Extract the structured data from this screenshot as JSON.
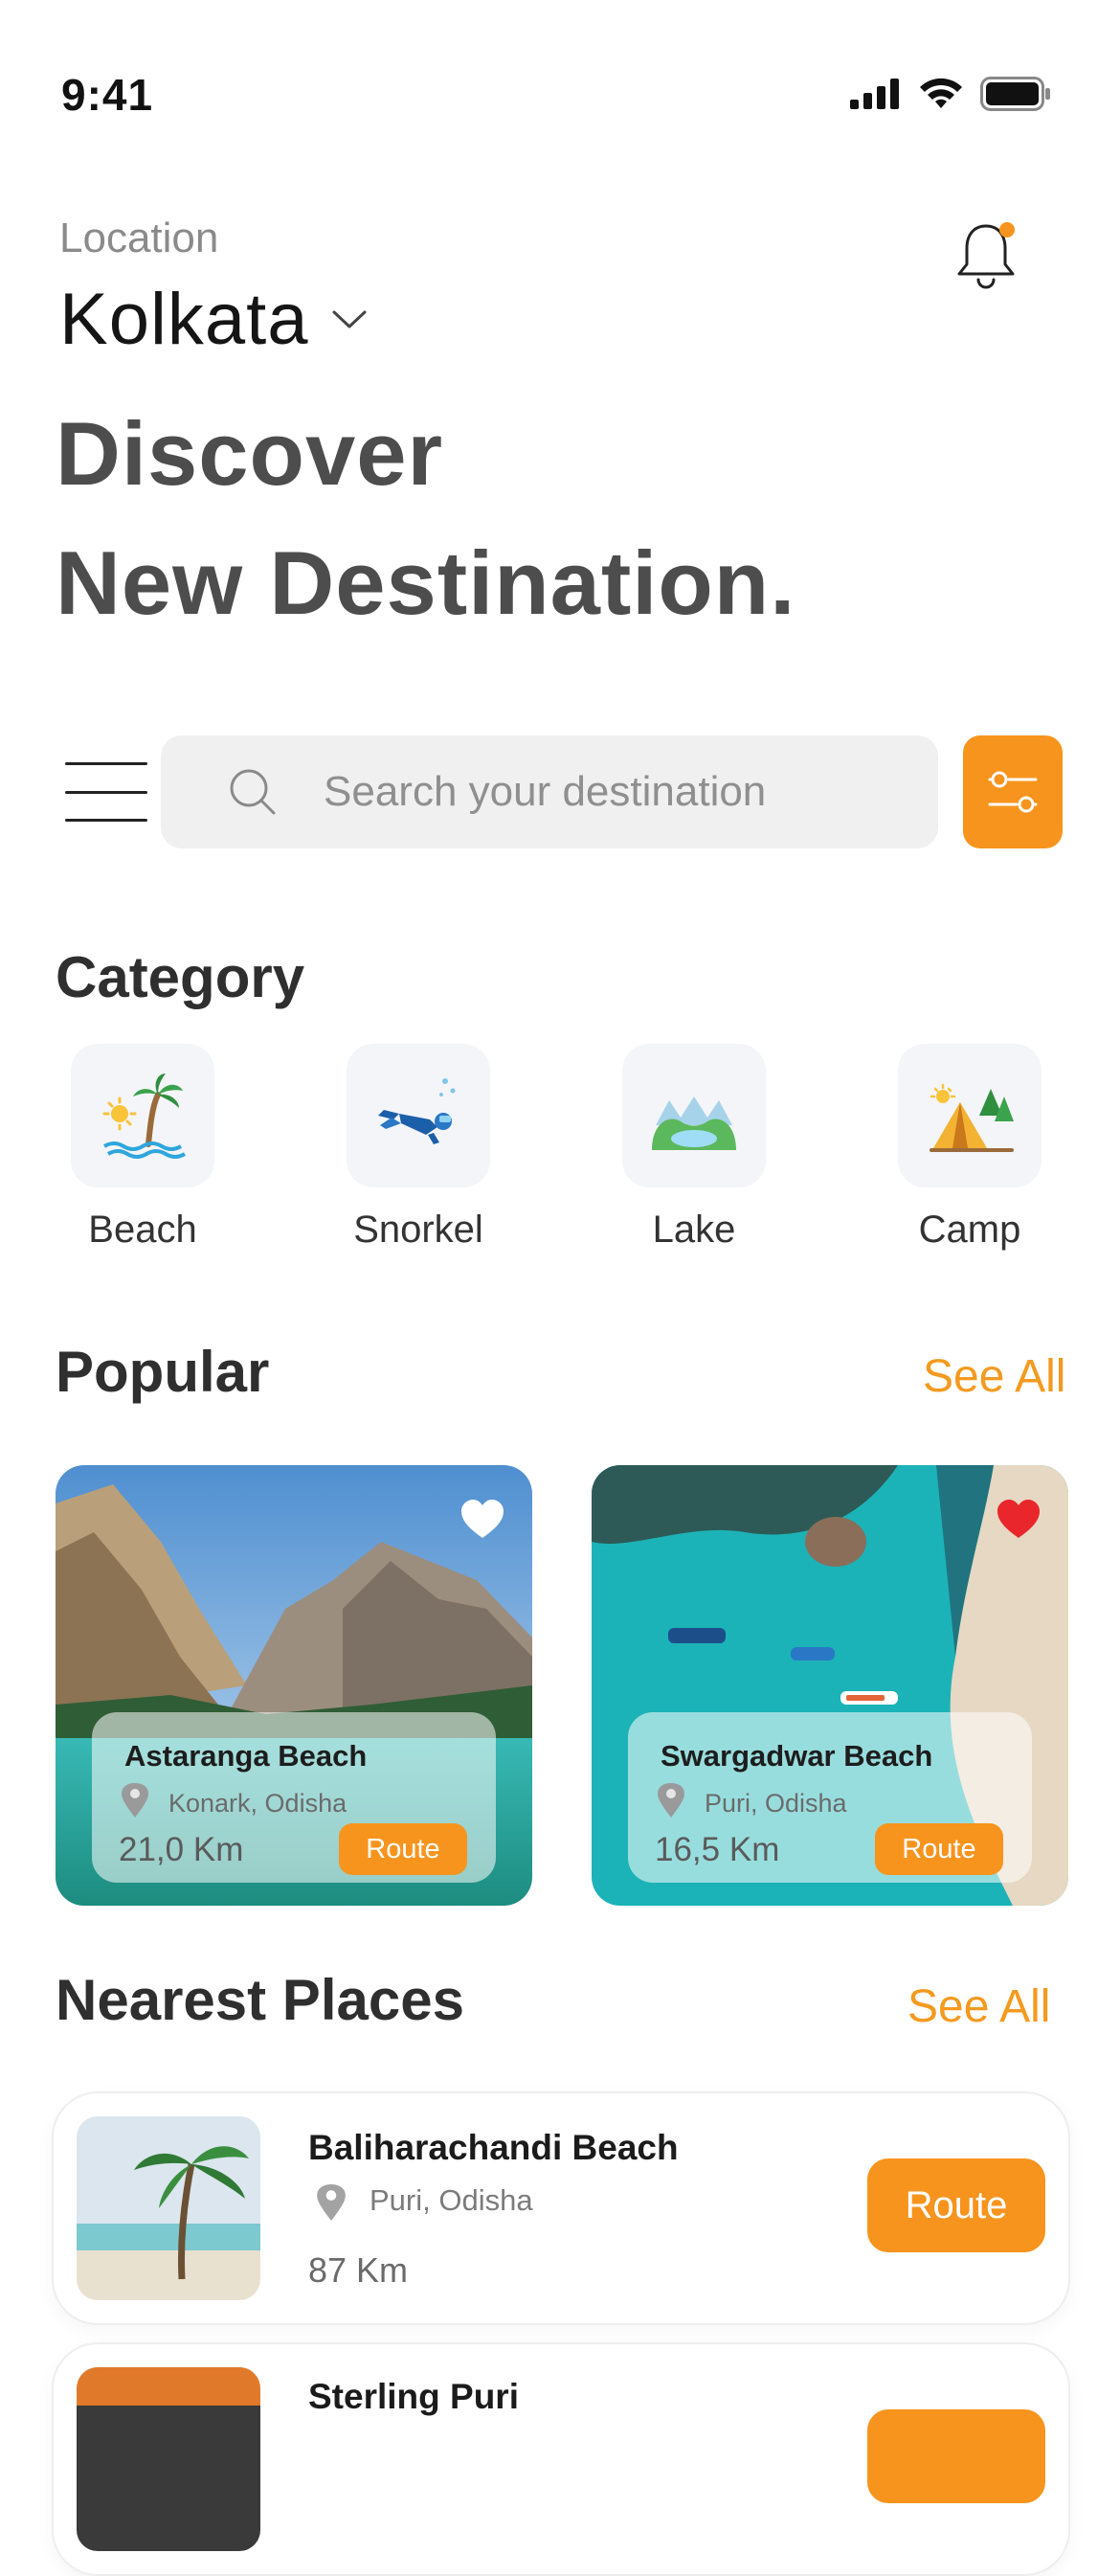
{
  "status_bar": {
    "time": "9:41"
  },
  "header": {
    "location_label": "Location",
    "city": "Kolkata",
    "headline_line1": "Discover",
    "headline_line2": "New Destination."
  },
  "search": {
    "placeholder": "Search your destination"
  },
  "category": {
    "title": "Category",
    "items": [
      {
        "label": "Beach",
        "icon": "beach-icon"
      },
      {
        "label": "Snorkel",
        "icon": "snorkel-icon"
      },
      {
        "label": "Lake",
        "icon": "lake-icon"
      },
      {
        "label": "Camp",
        "icon": "camp-icon"
      }
    ]
  },
  "popular": {
    "title": "Popular",
    "see_all": "See All",
    "cards": [
      {
        "name": "Astaranga Beach",
        "place": "Konark, Odisha",
        "distance": "21,0 Km",
        "route": "Route",
        "favorite": false
      },
      {
        "name": "Swargadwar Beach",
        "place": "Puri, Odisha",
        "distance": "16,5 Km",
        "route": "Route",
        "favorite": true
      }
    ]
  },
  "nearest": {
    "title": "Nearest Places",
    "see_all": "See All",
    "items": [
      {
        "name": "Baliharachandi Beach",
        "place": "Puri, Odisha",
        "distance": "87 Km",
        "route": "Route"
      },
      {
        "name": "Sterling Puri",
        "place": "",
        "distance": "",
        "route": ""
      }
    ]
  },
  "colors": {
    "accent": "#f7941d",
    "favorite_red": "#e8262b",
    "tile_bg": "#f4f5f9"
  }
}
